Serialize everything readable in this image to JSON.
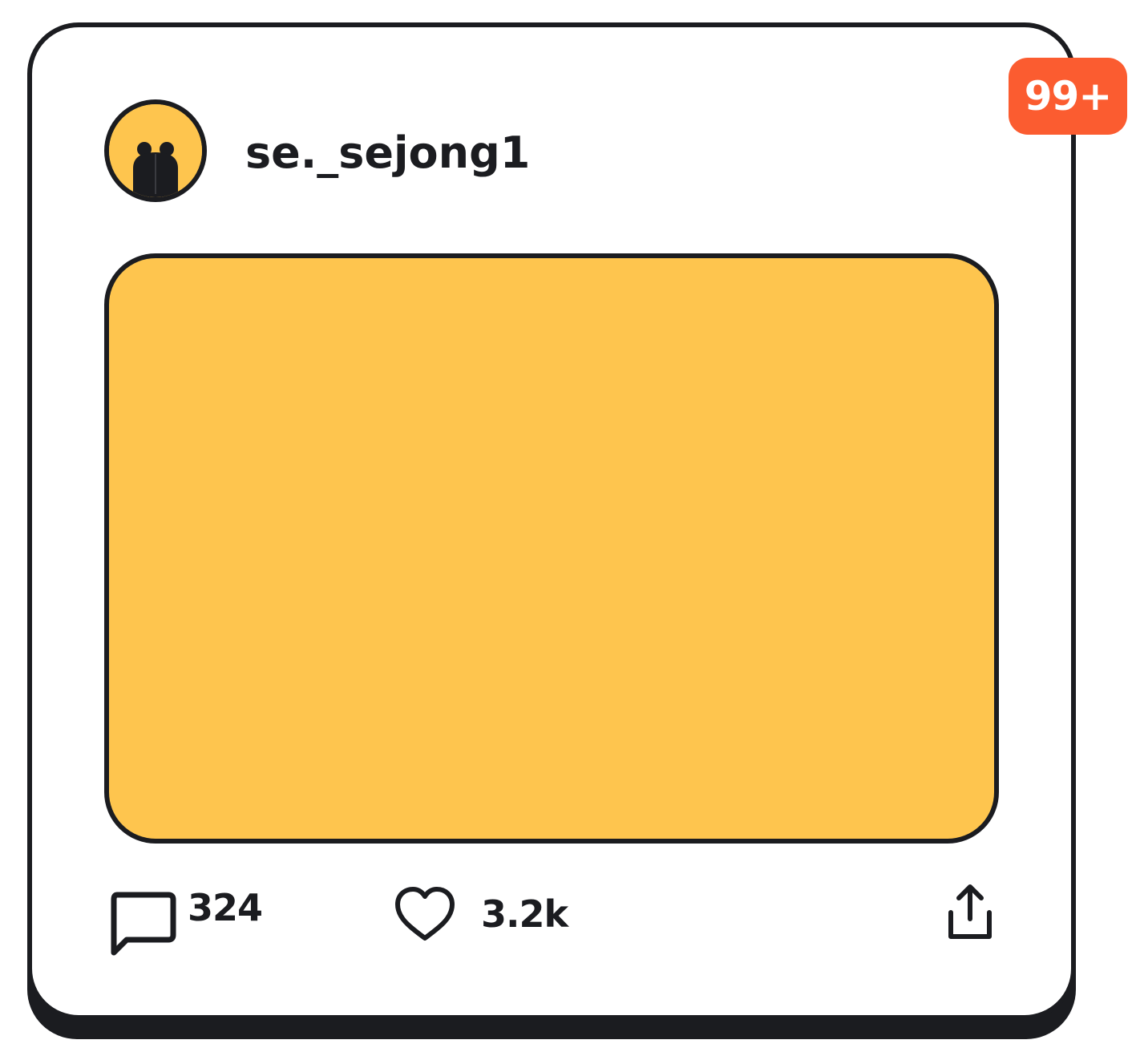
{
  "colors": {
    "ink": "#1b1c20",
    "accent_yellow": "#fec54e",
    "badge_orange": "#fb5c30",
    "card_background": "#ffffff"
  },
  "notification_badge": {
    "label": "99+"
  },
  "post": {
    "author": {
      "username": "se._sejong1",
      "avatar_icon": "person-silhouette-icon"
    },
    "media": {
      "state": "empty-placeholder"
    },
    "actions": {
      "comments": {
        "icon": "comment-icon",
        "count": "324"
      },
      "likes": {
        "icon": "heart-icon",
        "count": "3.2k"
      },
      "share": {
        "icon": "share-icon"
      }
    }
  }
}
